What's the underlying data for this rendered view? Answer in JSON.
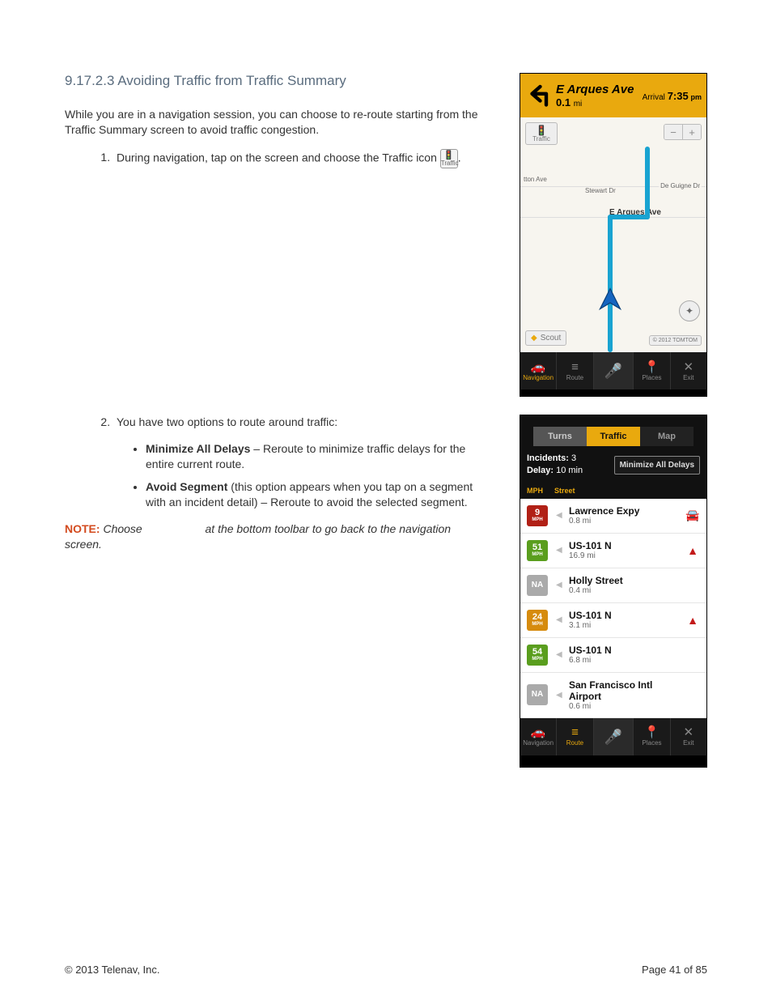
{
  "section": {
    "number": "9.17.2.3",
    "title": "Avoiding Traffic from Traffic Summary"
  },
  "intro": "While you are in a navigation session, you can choose to re-route starting from the Traffic Summary screen to avoid traffic congestion.",
  "step1_pre": "During navigation, tap on the screen and choose the Traffic icon",
  "traffic_icon_label": "Traffic",
  "step2_lead": "You have two options to route around traffic:",
  "opt_min_title": "Minimize All Delays",
  "opt_min_body": " – Reroute to minimize traffic delays for the entire current route.",
  "opt_avoid_title": "Avoid Segment",
  "opt_avoid_body": " (this option appears when you tap on a segment with an incident detail) – Reroute to avoid the selected segment.",
  "note_label": "NOTE:",
  "note_pre": "Choose",
  "note_post": "at the bottom toolbar to go back to the navigation screen.",
  "footer": {
    "copyright": "© 2013 Telenav, Inc.",
    "page": "Page 41 of 85"
  },
  "nav": {
    "street": "E Arques Ave",
    "dist_val": "0.1",
    "dist_unit": "mi",
    "arrival_label": "Arrival",
    "arrival_time": "7:35",
    "arrival_ampm": "pm",
    "traffic_btn": "Traffic",
    "zoom_minus": "−",
    "zoom_plus": "+",
    "labels": {
      "tton": "tton Ave",
      "stewart": "Stewart Dr",
      "guigne": "De Guigne Dr",
      "arques": "E Arques Ave"
    },
    "scout": "Scout",
    "tomtom": "© 2012 TOMTOM",
    "bottom": {
      "navigation": "Navigation",
      "route": "Route",
      "places": "Places",
      "exit": "Exit"
    }
  },
  "traffic": {
    "tabs": {
      "turns": "Turns",
      "traffic": "Traffic",
      "map": "Map"
    },
    "incidents_label": "Incidents:",
    "incidents_value": "3",
    "delay_label": "Delay:",
    "delay_value": "10 min",
    "min_all": "Minimize All Delays",
    "col_mph": "MPH",
    "col_street": "Street",
    "segments": [
      {
        "mph": "9",
        "mph_class": "red",
        "name": "Lawrence Expy",
        "dist": "0.8 mi",
        "icon": "car"
      },
      {
        "mph": "51",
        "mph_class": "green",
        "name": "US-101 N",
        "dist": "16.9 mi",
        "icon": "warn2"
      },
      {
        "mph": "NA",
        "mph_class": "na",
        "name": "Holly Street",
        "dist": "0.4 mi",
        "icon": ""
      },
      {
        "mph": "24",
        "mph_class": "orange",
        "name": "US-101 N",
        "dist": "3.1 mi",
        "icon": "warn1"
      },
      {
        "mph": "54",
        "mph_class": "green",
        "name": "US-101 N",
        "dist": "6.8 mi",
        "icon": ""
      },
      {
        "mph": "NA",
        "mph_class": "na",
        "name": "San Francisco Intl Airport",
        "dist": "0.6 mi",
        "icon": ""
      }
    ],
    "bottom": {
      "navigation": "Navigation",
      "route": "Route",
      "places": "Places",
      "exit": "Exit"
    }
  }
}
